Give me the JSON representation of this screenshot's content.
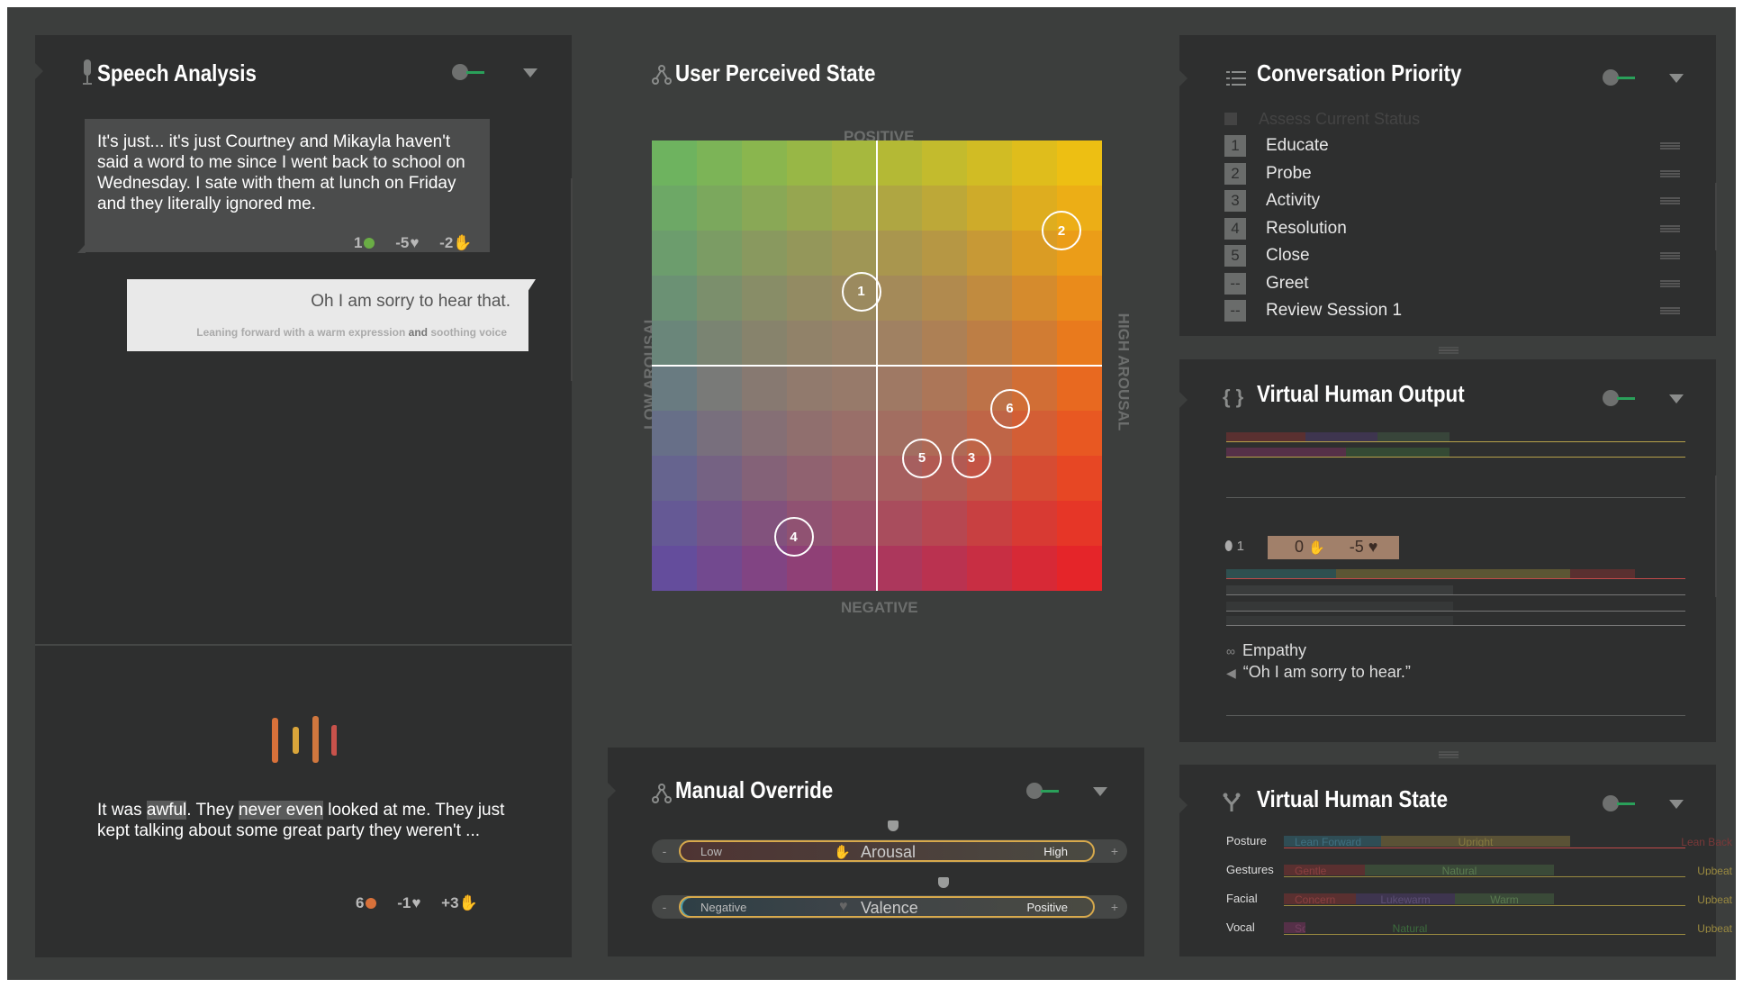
{
  "speech_analysis": {
    "title": "Speech Analysis",
    "user_message": "It's just... it's just Courtney and Mikayla haven't said a word to me since I went back to school on Wednesday. I sate with them at lunch on Friday and they literally ignored me.",
    "user_stats": {
      "count": "1",
      "heart": "-5",
      "hand": "-2"
    },
    "vh_reply": "Oh I am sorry to hear that.",
    "vh_nonverbal_pre": "Leaning forward with a warm expression ",
    "vh_nonverbal_and": "and",
    "vh_nonverbal_post": " soothing voice",
    "live_transcript": {
      "p1": "It was ",
      "h1": "awful",
      "p2": ". They ",
      "h2": "never even",
      "p3": " looked at me. They just kept talking about some great party they weren't ..."
    },
    "live_stats": {
      "count": "6",
      "heart": "-1",
      "hand": "+3"
    }
  },
  "user_perceived_state": {
    "title": "User Perceived State",
    "top_label": "POSITIVE",
    "bottom_label": "NEGATIVE",
    "left_label": "LOW AROUSAL",
    "right_label": "HIGH AROUSAL",
    "markers": [
      {
        "label": "1",
        "valence": 0.33,
        "arousal": -0.07
      },
      {
        "label": "2",
        "valence": 0.6,
        "arousal": 0.82
      },
      {
        "label": "3",
        "valence": -0.41,
        "arousal": 0.42
      },
      {
        "label": "4",
        "valence": -0.76,
        "arousal": -0.37
      },
      {
        "label": "5",
        "valence": -0.41,
        "arousal": 0.2
      },
      {
        "label": "6",
        "valence": -0.19,
        "arousal": 0.59
      }
    ]
  },
  "manual_override": {
    "title": "Manual Override",
    "arousal": {
      "low": "Low",
      "label": "Arousal",
      "high": "High",
      "minus": "-",
      "plus": "+",
      "value": 0.5
    },
    "valence": {
      "low": "Negative",
      "label": "Valence",
      "high": "Positive",
      "minus": "-",
      "plus": "+",
      "value": 0.6
    }
  },
  "conversation_priority": {
    "title": "Conversation Priority",
    "header_item": "Assess Current Status",
    "items": [
      {
        "num": "1",
        "label": "Educate"
      },
      {
        "num": "2",
        "label": "Probe"
      },
      {
        "num": "3",
        "label": "Activity"
      },
      {
        "num": "4",
        "label": "Resolution"
      },
      {
        "num": "5",
        "label": "Close"
      },
      {
        "num": "--",
        "label": "Greet"
      },
      {
        "num": "--",
        "label": "Review Session 1"
      }
    ]
  },
  "virtual_human_output": {
    "title": "Virtual Human Output",
    "title_icon": "{ }",
    "turn": "1",
    "hand_score": "0",
    "heart_score": "-5",
    "intent": "Empathy",
    "utterance": "“Oh I am sorry to hear.”"
  },
  "virtual_human_state": {
    "title": "Virtual Human State",
    "rows": [
      {
        "label": "Posture",
        "options": [
          "Lean Forward",
          "Upright",
          "Lean Back"
        ]
      },
      {
        "label": "Gestures",
        "options": [
          "Gentle",
          "Natural",
          "Upbeat"
        ]
      },
      {
        "label": "Facial",
        "options": [
          "Concern",
          "Lukewarm",
          "Warm",
          "Upbeat"
        ]
      },
      {
        "label": "Vocal",
        "options": [
          "Soothing",
          "Natural",
          "Upbeat"
        ]
      }
    ]
  },
  "colors": {
    "accent_green": "#2aa05a",
    "panel": "#2e2f2f",
    "background": "#3c3e3d",
    "slider_border": "#d7a94c"
  }
}
